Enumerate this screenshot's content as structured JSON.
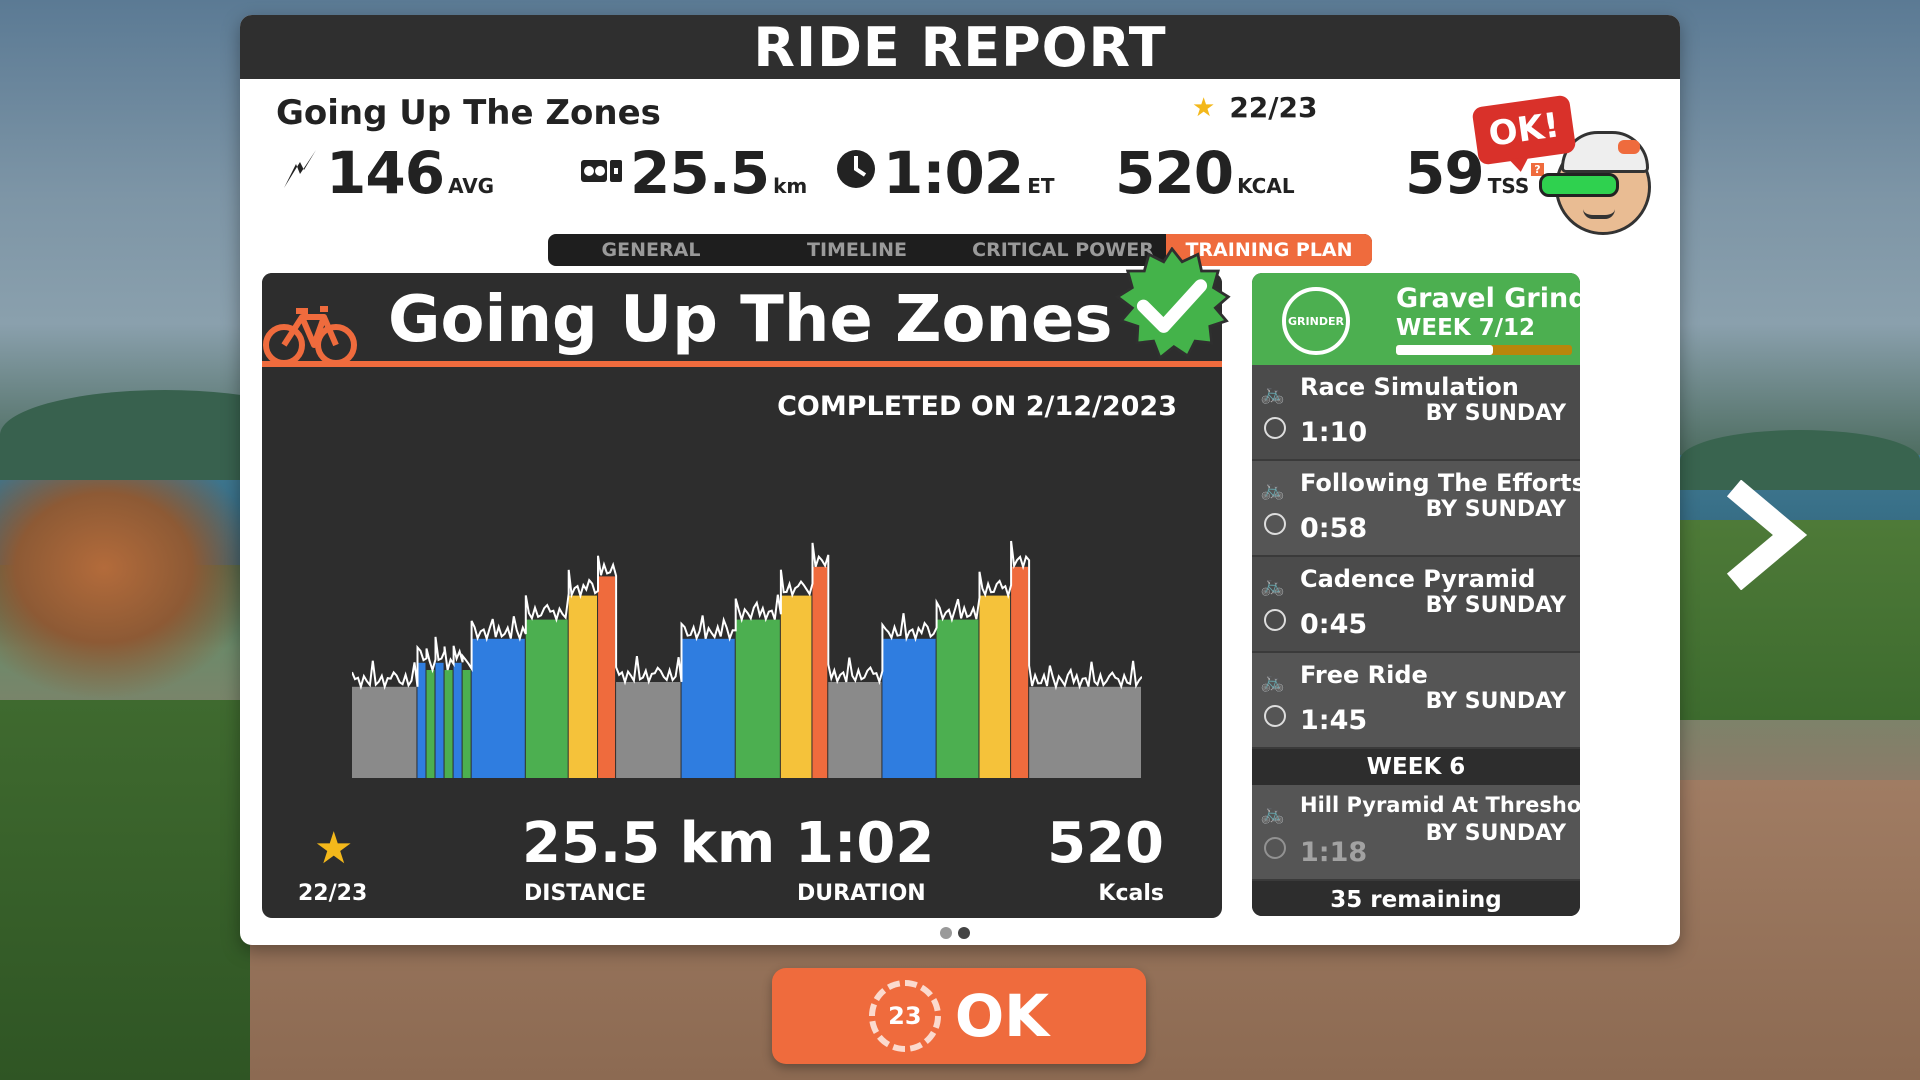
{
  "header": {
    "title": "RIDE REPORT"
  },
  "summary": {
    "ride_name": "Going Up The Zones",
    "stars": "22/23",
    "power": {
      "value": "146",
      "unit": "AVG",
      "icon": "power-icon"
    },
    "distance": {
      "value": "25.5",
      "unit": "km",
      "icon": "bike-distance-icon"
    },
    "elapsed": {
      "value": "1:02",
      "unit": "ET",
      "icon": "clock-icon"
    },
    "calories": {
      "value": "520",
      "unit": "KCAL"
    },
    "tss": {
      "value": "59",
      "unit": "TSS",
      "info": "?"
    },
    "avatar_bubble": "OK!"
  },
  "tabs": [
    {
      "label": "GENERAL"
    },
    {
      "label": "TIMELINE"
    },
    {
      "label": "CRITICAL POWER"
    },
    {
      "label": "TRAINING PLAN",
      "active": true
    }
  ],
  "workout": {
    "title": "Going Up The Zones",
    "completed": "COMPLETED ON 2/12/2023",
    "stars": "22/23",
    "distance": {
      "value": "25.5 km",
      "label": "DISTANCE"
    },
    "duration": {
      "value": "1:02",
      "label": "DURATION"
    },
    "calories": {
      "value": "520",
      "label": "Kcals"
    }
  },
  "plan": {
    "logo_text": "GRINDER",
    "title": "Gravel Grind...",
    "week": "WEEK 7/12",
    "progress": 0.55,
    "items": [
      {
        "name": "Race Simulation",
        "time": "1:10",
        "due": "BY SUNDAY"
      },
      {
        "name": "Following The Efforts",
        "time": "0:58",
        "due": "BY SUNDAY"
      },
      {
        "name": "Cadence Pyramid",
        "time": "0:45",
        "due": "BY SUNDAY"
      },
      {
        "name": "Free Ride",
        "time": "1:45",
        "due": "BY SUNDAY"
      }
    ],
    "week6_label": "WEEK 6",
    "week6_item": {
      "name": "Hill Pyramid At Threshold",
      "time": "1:18",
      "due": "BY SUNDAY"
    },
    "remaining": "35 remaining"
  },
  "ok_button": {
    "badge": "23",
    "label": "OK"
  },
  "colors": {
    "accent": "#ef6b3d",
    "zone_gray": "#8a8a8a",
    "zone_blue": "#2f7de0",
    "zone_green": "#4caf50",
    "zone_yellow": "#f5c23a",
    "zone_orange": "#ef6b3d",
    "plan_green": "#4caf50"
  },
  "chart_data": {
    "type": "bar",
    "segments": [
      {
        "zone": "gray",
        "level": 0.38
      },
      {
        "zone": "blue",
        "level": 0.48
      },
      {
        "zone": "green",
        "level": 0.45
      },
      {
        "zone": "blue",
        "level": 0.48
      },
      {
        "zone": "green",
        "level": 0.45
      },
      {
        "zone": "blue",
        "level": 0.48
      },
      {
        "zone": "green",
        "level": 0.45
      },
      {
        "zone": "blue",
        "level": 0.58
      },
      {
        "zone": "green",
        "level": 0.66
      },
      {
        "zone": "yellow",
        "level": 0.76
      },
      {
        "zone": "orange",
        "level": 0.84
      },
      {
        "zone": "gray",
        "level": 0.4
      },
      {
        "zone": "blue",
        "level": 0.58
      },
      {
        "zone": "green",
        "level": 0.66
      },
      {
        "zone": "yellow",
        "level": 0.76
      },
      {
        "zone": "orange",
        "level": 0.88
      },
      {
        "zone": "gray",
        "level": 0.4
      },
      {
        "zone": "blue",
        "level": 0.58
      },
      {
        "zone": "green",
        "level": 0.66
      },
      {
        "zone": "yellow",
        "level": 0.76
      },
      {
        "zone": "orange",
        "level": 0.88
      },
      {
        "zone": "gray",
        "level": 0.38
      }
    ]
  }
}
